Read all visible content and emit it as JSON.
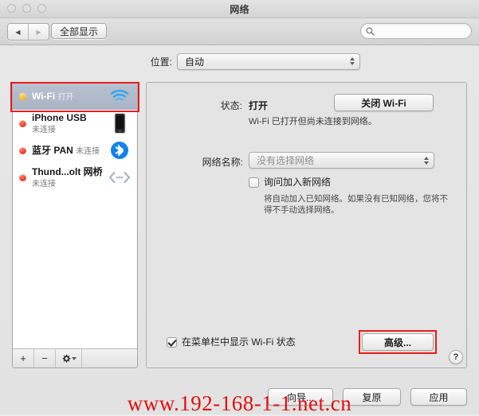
{
  "window": {
    "title": "网络",
    "traffic_lights": [
      "close",
      "minimize",
      "zoom"
    ]
  },
  "toolbar": {
    "back_icon": "chevron-left-icon",
    "forward_icon": "chevron-right-icon",
    "show_all_label": "全部显示",
    "search": {
      "value": "",
      "placeholder": "",
      "icon": "search-icon"
    }
  },
  "location": {
    "label": "位置:",
    "selected": "自动"
  },
  "sidebar": {
    "interfaces": [
      {
        "name": "Wi-Fi",
        "status": "打开",
        "dot": "amber",
        "icon": "wifi-icon",
        "selected": true
      },
      {
        "name": "iPhone USB",
        "status": "未连接",
        "dot": "red",
        "icon": "iphone-icon",
        "selected": false
      },
      {
        "name": "蓝牙 PAN",
        "status": "未连接",
        "dot": "red",
        "icon": "bluetooth-icon",
        "selected": false
      },
      {
        "name": "Thund...olt 网桥",
        "status": "未连接",
        "dot": "red",
        "icon": "thunderbolt-bridge-icon",
        "selected": false
      }
    ],
    "toolbar": {
      "add_label": "+",
      "remove_label": "−",
      "gear_icon": "gear-icon"
    }
  },
  "panel": {
    "status_label": "状态:",
    "status_value": "打开",
    "status_description": "Wi-Fi 已打开但尚未连接到网络。",
    "wifi_toggle_label": "关闭 Wi-Fi",
    "network_name_label": "网络名称:",
    "network_name_selected": "没有选择网络",
    "ask_join_label": "询问加入新网络",
    "ask_join_checked": false,
    "ask_join_description": "将自动加入已知网络。如果没有已知网络，您将不得不手动选择网络。",
    "show_menubar_label": "在菜单栏中显示 Wi-Fi 状态",
    "show_menubar_checked": true,
    "advanced_label": "高级...",
    "help_label": "?"
  },
  "footer": {
    "assistant_label": "向导...",
    "revert_label": "复原",
    "apply_label": "应用"
  },
  "watermark": {
    "text": "www.192-168-1-1.net.cn",
    "color": "#e01010"
  },
  "highlights": {
    "color": "#e81c1c"
  }
}
